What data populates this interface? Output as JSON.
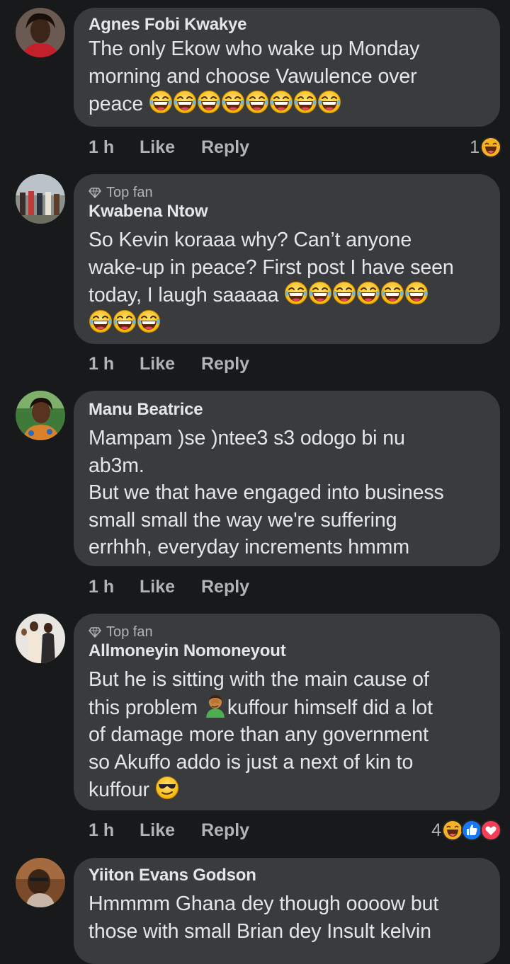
{
  "comments": [
    {
      "name": "Agnes Fobi Kwakye",
      "top_fan": "",
      "text_before": "The only Ekow who wake up Monday\nmorning and choose Vawulence over\npeace ",
      "text_emoji": "😂😂😂😂😂😂😂😂",
      "text_after": "",
      "time": "1 h",
      "like": "Like",
      "reply": "Reply",
      "reaction_count": "1",
      "reaction_icons": [
        "haha-icon"
      ]
    },
    {
      "name": "Kwabena Ntow",
      "top_fan": "Top fan",
      "text_before": "So Kevin koraaa why? Can’t anyone\nwake-up in peace? First post I have seen\ntoday, I laugh saaaaa ",
      "text_emoji": "😂😂😂😂😂😂😂😂😂",
      "text_after": "",
      "time": "1 h",
      "like": "Like",
      "reply": "Reply",
      "reaction_count": "",
      "reaction_icons": []
    },
    {
      "name": "Manu Beatrice",
      "top_fan": "",
      "text_before": "Mampam )se )ntee3 s3 odogo bi nu\nab3m.\nBut we that have engaged into business\nsmall small the way we're suffering\nerrhhh, everyday increments hmmm",
      "text_emoji": "",
      "text_after": "",
      "time": "1 h",
      "like": "Like",
      "reply": "Reply",
      "reaction_count": "",
      "reaction_icons": []
    },
    {
      "name": "Allmoneyin Nomoneyout",
      "top_fan": "Top fan",
      "text_before": "But he is sitting with the main cause of\nthis problem ",
      "text_emoji": "🤦‍♂️",
      "text_after": "kuffour himself did a lot\nof damage more than any government\nso Akuffo addo is just a next of kin to\nkuffour ",
      "text_emoji2": "😎",
      "time": "1 h",
      "like": "Like",
      "reply": "Reply",
      "reaction_count": "4",
      "reaction_icons": [
        "haha-icon",
        "like-icon",
        "love-icon"
      ]
    },
    {
      "name": "Yiiton Evans Godson",
      "top_fan": "",
      "text_before": "Hmmmm Ghana dey though oooow but\nthose with small Brian dey Insult kelvin",
      "text_emoji": "",
      "text_after": "",
      "time": "",
      "like": "",
      "reply": "",
      "reaction_count": "",
      "reaction_icons": []
    }
  ],
  "colors": {
    "background": "#18191a",
    "bubble": "#3a3b3c",
    "text": "#e4e6eb",
    "muted": "#b0b3b8"
  }
}
